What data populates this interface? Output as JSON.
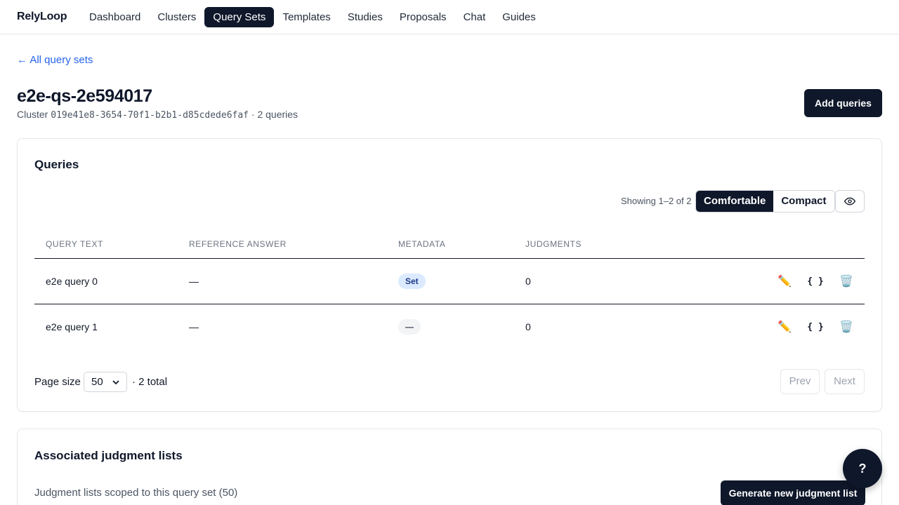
{
  "app": {
    "brand": "RelyLoop"
  },
  "nav": {
    "items": [
      {
        "label": "Dashboard"
      },
      {
        "label": "Clusters"
      },
      {
        "label": "Query Sets"
      },
      {
        "label": "Templates"
      },
      {
        "label": "Studies"
      },
      {
        "label": "Proposals"
      },
      {
        "label": "Chat"
      },
      {
        "label": "Guides"
      }
    ],
    "active": "Query Sets"
  },
  "back_link": "← All query sets",
  "header": {
    "title": "e2e-qs-2e594017",
    "cluster_prefix": "Cluster",
    "cluster_id": "019e41e8-3654-70f1-b2b1-d85cdede6faf",
    "query_count": "· 2 queries",
    "add_button": "Add queries"
  },
  "queries_card": {
    "title": "Queries",
    "showing": "Showing 1–2 of 2",
    "density": {
      "comfortable": "Comfortable",
      "compact": "Compact",
      "selected": "Comfortable"
    },
    "columns_toggle_icon": "eye-icon",
    "columns": [
      "Query text",
      "Reference answer",
      "Metadata",
      "Judgments"
    ],
    "rows": [
      {
        "query_text": "e2e query 0",
        "reference_answer": "—",
        "metadata": "Set",
        "judgments": "0"
      },
      {
        "query_text": "e2e query 1",
        "reference_answer": "—",
        "metadata": "—",
        "judgments": "0"
      }
    ],
    "row_action_icons": [
      "pencil-icon",
      "json-braces-icon",
      "trash-icon"
    ],
    "row_action_glyphs": {
      "edit": "✏️",
      "json": "{ }",
      "delete": "🗑️"
    },
    "pagination": {
      "page_size_label": "Page size",
      "page_size_value": "50",
      "total": "· 2 total",
      "prev": "Prev",
      "next": "Next"
    }
  },
  "judgment_card": {
    "title": "Associated judgment lists",
    "description": "Judgment lists scoped to this query set (50)",
    "generate_button": "Generate new judgment list"
  },
  "help_button": "?",
  "colors": {
    "primary": "#0f172a",
    "link": "#2563eb",
    "badge_set_bg": "#dbeafe",
    "badge_set_text": "#1e3a8a"
  }
}
